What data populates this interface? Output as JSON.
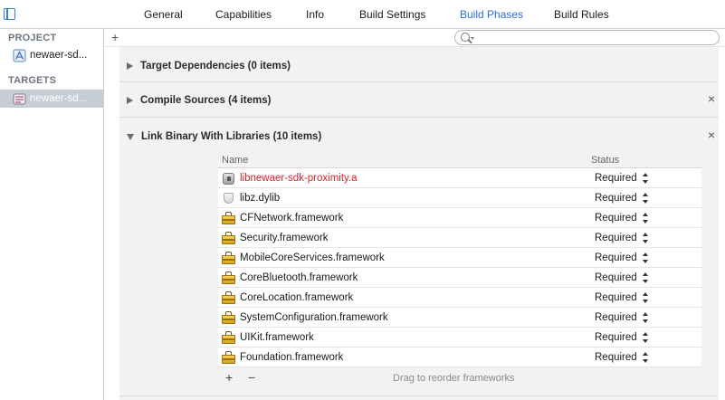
{
  "tabs": [
    {
      "label": "General",
      "active": false
    },
    {
      "label": "Capabilities",
      "active": false
    },
    {
      "label": "Info",
      "active": false
    },
    {
      "label": "Build Settings",
      "active": false
    },
    {
      "label": "Build Phases",
      "active": true
    },
    {
      "label": "Build Rules",
      "active": false
    }
  ],
  "sidebar": {
    "project_heading": "PROJECT",
    "project_item": "newaer-sd...",
    "targets_heading": "TARGETS",
    "target_item": "newaer-sd..."
  },
  "toolbar": {
    "add_label": "+",
    "search_placeholder": ""
  },
  "phases": [
    {
      "title": "Target Dependencies (0 items)",
      "expanded": false,
      "closable": false
    },
    {
      "title": "Compile Sources (4 items)",
      "expanded": false,
      "closable": true,
      "close_label": "×"
    },
    {
      "title": "Link Binary With Libraries (10 items)",
      "expanded": true,
      "closable": true,
      "close_label": "×"
    }
  ],
  "libraries": {
    "columns": {
      "name": "Name",
      "status": "Status"
    },
    "items": [
      {
        "name": "libnewaer-sdk-proximity.a",
        "status": "Required",
        "icon": "static-library-icon",
        "missing": true
      },
      {
        "name": "libz.dylib",
        "status": "Required",
        "icon": "dylib-icon",
        "missing": false
      },
      {
        "name": "CFNetwork.framework",
        "status": "Required",
        "icon": "framework-icon",
        "missing": false
      },
      {
        "name": "Security.framework",
        "status": "Required",
        "icon": "framework-icon",
        "missing": false
      },
      {
        "name": "MobileCoreServices.framework",
        "status": "Required",
        "icon": "framework-icon",
        "missing": false
      },
      {
        "name": "CoreBluetooth.framework",
        "status": "Required",
        "icon": "framework-icon",
        "missing": false
      },
      {
        "name": "CoreLocation.framework",
        "status": "Required",
        "icon": "framework-icon",
        "missing": false
      },
      {
        "name": "SystemConfiguration.framework",
        "status": "Required",
        "icon": "framework-icon",
        "missing": false
      },
      {
        "name": "UIKit.framework",
        "status": "Required",
        "icon": "framework-icon",
        "missing": false
      },
      {
        "name": "Foundation.framework",
        "status": "Required",
        "icon": "framework-icon",
        "missing": false
      }
    ],
    "footer": {
      "add_label": "+",
      "remove_label": "−",
      "hint": "Drag to reorder frameworks"
    }
  },
  "colors": {
    "active_tab": "#2d6ee0",
    "missing_library": "#d3232b",
    "selected_row": "#c6cdd6"
  }
}
